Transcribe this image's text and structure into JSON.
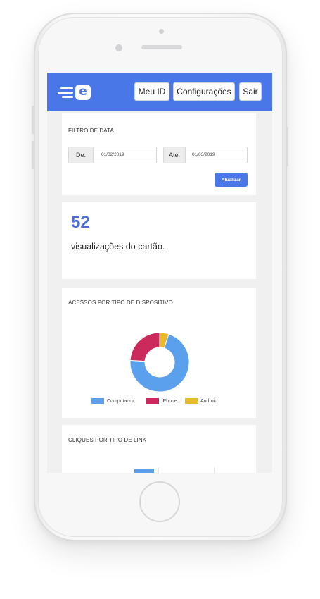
{
  "header": {
    "logo_letter": "e",
    "nav": [
      "Meu ID",
      "Configurações",
      "Sair"
    ],
    "brand_color": "#4a77e8"
  },
  "date_filter": {
    "title": "FILTRO DE DATA",
    "from_label": "De:",
    "from_value": "01/02/2019",
    "to_label": "Até:",
    "to_value": "01/03/2019",
    "update_button": "Atualizar"
  },
  "views": {
    "count": "52",
    "caption": "visualizações do cartão."
  },
  "device_chart": {
    "title": "ACESSOS POR TIPO DE DISPOSITIVO",
    "chart_data": {
      "type": "pie",
      "donut": true,
      "categories": [
        "Computador",
        "iPhone",
        "Android"
      ],
      "values": [
        71,
        24,
        5
      ],
      "colors": [
        "#5aa0ec",
        "#cc2a5c",
        "#e8b928"
      ],
      "legend": "bottom"
    }
  },
  "link_chart": {
    "title": "CLIQUES POR TIPO DE LINK"
  }
}
